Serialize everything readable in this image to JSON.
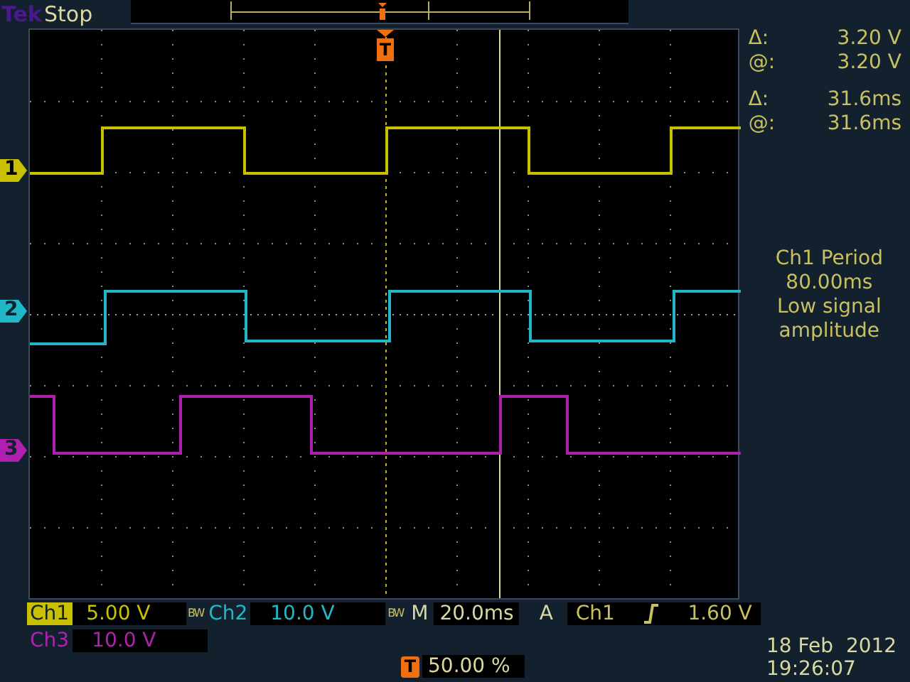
{
  "status": {
    "brand": "Tek",
    "state": "Stop"
  },
  "trigger_marker": "T",
  "cursor_readouts": [
    {
      "symbol": "Δ:",
      "value": "3.20 V"
    },
    {
      "symbol": "@:",
      "value": "3.20 V"
    },
    {
      "symbol": "Δ:",
      "value": "31.6ms"
    },
    {
      "symbol": "@:",
      "value": "31.6ms"
    }
  ],
  "measurement": [
    "Ch1 Period",
    "80.00ms",
    "Low signal",
    "amplitude"
  ],
  "channels": [
    {
      "marker": "1",
      "label": "Ch1",
      "scale": "5.00 V",
      "bw": "BW",
      "selected": true,
      "color": "#c8c000"
    },
    {
      "marker": "2",
      "label": "Ch2",
      "scale": "10.0 V",
      "bw": "BW",
      "selected": false,
      "color": "#20b8c8"
    },
    {
      "marker": "3",
      "label": "Ch3",
      "scale": "10.0 V",
      "selected": false,
      "color": "#b020b0"
    }
  ],
  "timebase": {
    "label": "M",
    "value": "20.0ms"
  },
  "trigger": {
    "label": "A",
    "source": "Ch1",
    "kind": "rising",
    "level": "1.60 V"
  },
  "trigger_position": {
    "marker": "T",
    "value": "50.00 %"
  },
  "date": "18 Feb  2012",
  "time": "19:26:07"
}
